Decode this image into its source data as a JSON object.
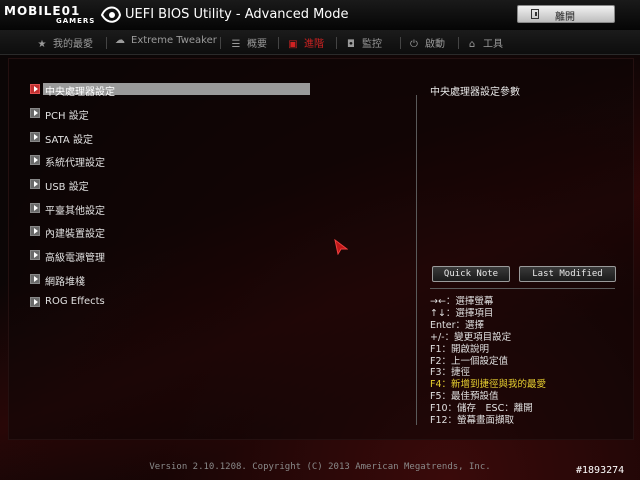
{
  "header": {
    "logo_text": "MOBILE01",
    "logo_sub": "GAMERS",
    "title": "UEFI BIOS Utility - Advanced Mode",
    "exit_label": "離開"
  },
  "tabs": [
    {
      "label": "我的最愛",
      "icon": "star-icon"
    },
    {
      "label": "Extreme Tweaker",
      "icon": "cloud-icon"
    },
    {
      "label": "概要",
      "icon": "list-icon"
    },
    {
      "label": "進階",
      "icon": "advanced-icon",
      "active": true
    },
    {
      "label": "監控",
      "icon": "monitor-icon"
    },
    {
      "label": "啟動",
      "icon": "power-icon"
    },
    {
      "label": "工具",
      "icon": "tool-icon"
    }
  ],
  "menu_items": [
    "中央處理器設定",
    "PCH 設定",
    "SATA 設定",
    "系統代理設定",
    "USB 設定",
    "平臺其他設定",
    "內建裝置設定",
    "高級電源管理",
    "網路堆棧",
    "ROG Effects"
  ],
  "help": {
    "title": "中央處理器設定參數",
    "quick_note": "Quick Note",
    "last_modified": "Last Modified"
  },
  "keys": [
    "→←：選擇螢幕",
    "↑↓：選擇項目",
    "Enter：選擇",
    "+/-：變更項目設定",
    "F1：開啟說明",
    "F2：上一個設定值",
    "F3：捷徑",
    "F4：新增到捷徑與我的最愛",
    "F5：最佳預設值",
    "F10：儲存　ESC：離開",
    "F12：螢幕畫面擷取"
  ],
  "footer": "Version 2.10.1208. Copyright (C) 2013 American Megatrends, Inc.",
  "tag": "#1893274",
  "colors": {
    "accent": "#d02222",
    "highlight": "#e8d030"
  }
}
